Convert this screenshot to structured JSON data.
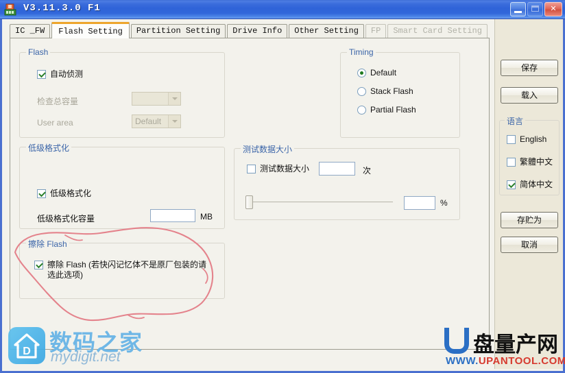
{
  "window": {
    "title": "V3.11.3.0 F1",
    "icon": "app-icon",
    "buttons": {
      "minimize": "minimize-icon",
      "maximize": "maximize-icon",
      "close": "close-icon"
    }
  },
  "tabs": [
    {
      "label": "IC _FW",
      "state": "normal"
    },
    {
      "label": "Flash Setting",
      "state": "active"
    },
    {
      "label": "Partition Setting",
      "state": "normal"
    },
    {
      "label": "Drive Info",
      "state": "normal"
    },
    {
      "label": "Other Setting",
      "state": "normal"
    },
    {
      "label": "FP",
      "state": "disabled"
    },
    {
      "label": "Smart Card Setting",
      "state": "disabled"
    }
  ],
  "flash_group": {
    "legend": "Flash",
    "auto_detect": {
      "label": "自动侦测",
      "checked": true
    },
    "total_capacity": {
      "label": "检查总容量",
      "value": "",
      "disabled": true
    },
    "user_area": {
      "label": "User area",
      "value": "Default",
      "disabled": true
    }
  },
  "lowlevel_group": {
    "legend": "低级格式化",
    "enable": {
      "label": "低级格式化",
      "checked": true
    },
    "capacity": {
      "label": "低级格式化容量",
      "value": "",
      "unit": "MB"
    }
  },
  "erase_group": {
    "legend": "擦除 Flash",
    "erase": {
      "label": "擦除 Flash (若快闪记忆体不是原厂包装的请选此选项)",
      "checked": true
    }
  },
  "timing_group": {
    "legend": "Timing",
    "options": [
      {
        "label": "Default",
        "selected": true
      },
      {
        "label": "Stack Flash",
        "selected": false
      },
      {
        "label": "Partial Flash",
        "selected": false
      }
    ]
  },
  "testdata_group": {
    "legend": "测试数据大小",
    "enable": {
      "label": "测试数据大小",
      "checked": false
    },
    "count": {
      "value": "",
      "unit": "次"
    },
    "slider": {
      "value": 0,
      "min": 0,
      "max": 100
    },
    "percent": {
      "value": "",
      "unit": "%"
    }
  },
  "sidepanel": {
    "save_button": "保存",
    "load_button": "载入",
    "language_group": {
      "legend": "语言",
      "options": [
        {
          "label": "English",
          "checked": false
        },
        {
          "label": "繁體中文",
          "checked": false
        },
        {
          "label": "简体中文",
          "checked": true
        }
      ]
    },
    "save_as_button": "存贮为",
    "cancel_button": "取消"
  },
  "annotation": {
    "type": "hand-drawn-circle",
    "color": "#e4838c",
    "target": "erase_group"
  },
  "watermarks": {
    "mydigit": {
      "cn": "数码之家",
      "en": "mydigit.net"
    },
    "upantool": {
      "cn": "盘量产网",
      "en_www": "WWW.",
      "en_main": "UPANTOOL",
      "en_dot": ".",
      "en_com": "COM"
    }
  }
}
